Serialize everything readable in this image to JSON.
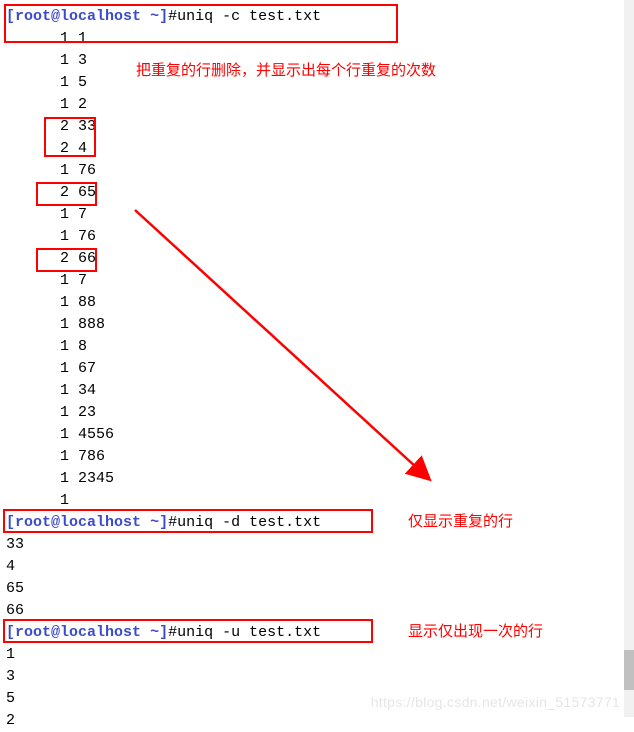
{
  "prompt": {
    "user": "root",
    "host": "localhost",
    "dir": "~",
    "symbol": "#"
  },
  "cmd1": {
    "prefix": "[root@localhost ~]#",
    "command": "uniq -c test.txt",
    "output": [
      "      1 1",
      "      1 3",
      "      1 5",
      "      1 2",
      "      2 33",
      "      2 4",
      "      1 76",
      "      2 65",
      "      1 7",
      "      1 76",
      "      2 66",
      "      1 7",
      "      1 88",
      "      1 888",
      "      1 8",
      "      1 67",
      "      1 34",
      "      1 23",
      "      1 4556",
      "      1 786",
      "      1 2345",
      "      1"
    ]
  },
  "cmd2": {
    "prefix": "[root@localhost ~]#",
    "command": "uniq -d test.txt",
    "output": [
      "33",
      "4",
      "65",
      "66"
    ]
  },
  "cmd3": {
    "prefix": "[root@localhost ~]#",
    "command": "uniq -u test.txt",
    "output": [
      "1",
      "3",
      "5",
      "2"
    ]
  },
  "annotations": {
    "a1": "把重复的行删除，并显示出每个行重复的次数",
    "a2": "仅显示重复的行",
    "a3": "显示仅出现一次的行"
  },
  "watermark": "https://blog.csdn.net/weixin_51573771"
}
